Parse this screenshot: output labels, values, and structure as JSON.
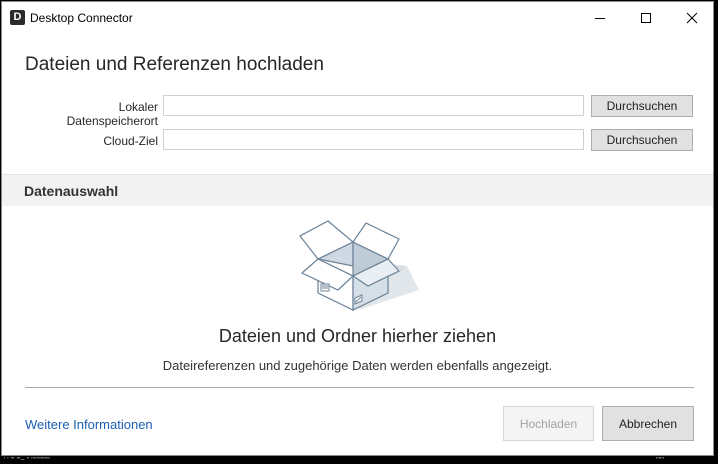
{
  "window": {
    "title": "Desktop Connector",
    "app_icon_letter": "D"
  },
  "form": {
    "heading": "Dateien und Referenzen hochladen",
    "local_label": "Lokaler Datenspeicherort",
    "local_value": "",
    "cloud_label": "Cloud-Ziel",
    "cloud_value": "",
    "browse_label": "Durchsuchen"
  },
  "section": {
    "title": "Datenauswahl"
  },
  "dropzone": {
    "heading": "Dateien und Ordner hierher ziehen",
    "subtext": "Dateireferenzen und zugehörige Daten werden ebenfalls angezeigt.",
    "illustration_icon": "open-box-icon"
  },
  "footer": {
    "more_info_link": "Weitere Informationen",
    "upload_label": "Hochladen",
    "upload_enabled": false,
    "cancel_label": "Abbrechen"
  },
  "background": {
    "left_fragment": "' ' ''' '''~ '' ''''''''''''''",
    "right_fragment": "''''''"
  },
  "colors": {
    "link": "#1a5fb4",
    "section_band": "#f2f2f2",
    "button_face": "#e1e1e1",
    "illustration_outline": "#6c8297"
  }
}
